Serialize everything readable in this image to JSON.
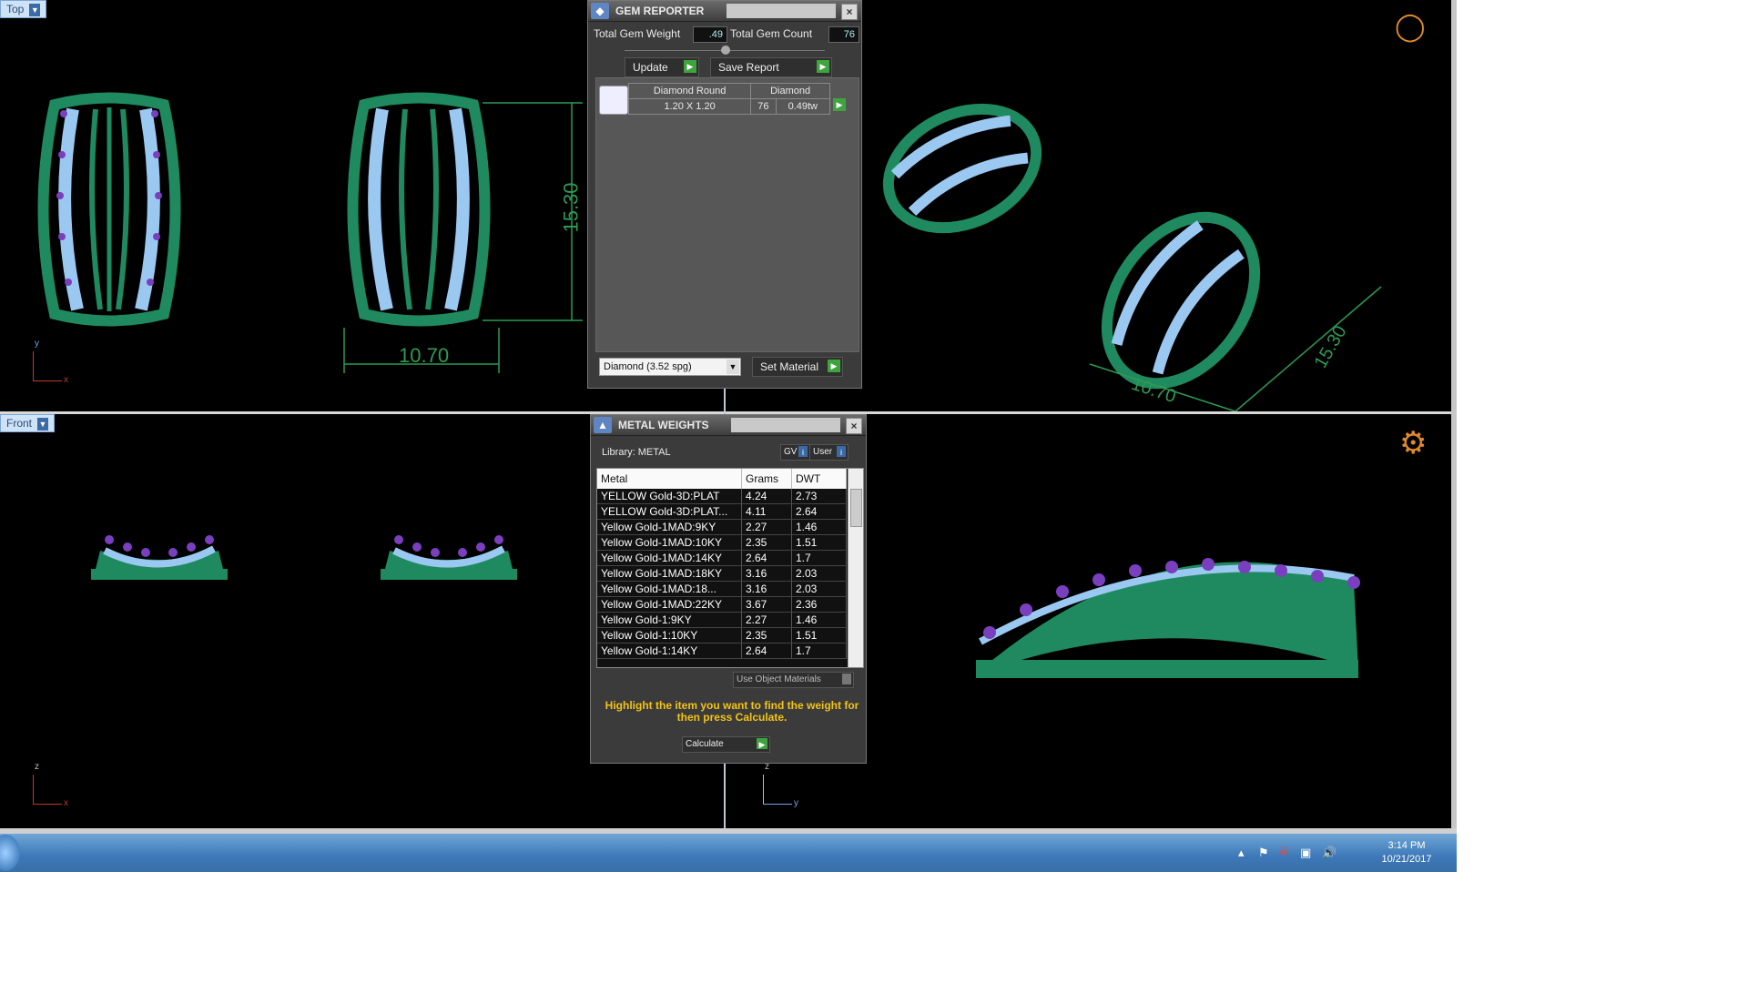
{
  "viewports": {
    "top": {
      "label": "Top",
      "dim_height": "15.30",
      "dim_width": "10.70",
      "axis_v": "y",
      "axis_h": "x"
    },
    "perspective": {
      "dim_width": "10.70",
      "dim_height": "15.30"
    },
    "front": {
      "label": "Front",
      "axis_v": "z",
      "axis_h": "x"
    },
    "right": {
      "axis_v": "z",
      "axis_h": "y"
    }
  },
  "gem_reporter": {
    "title": "GEM REPORTER",
    "total_weight_label": "Total Gem Weight",
    "total_weight_value": ".49",
    "total_count_label": "Total Gem Count",
    "total_count_value": "76",
    "update_label": "Update",
    "save_report_label": "Save Report",
    "gem": {
      "shape": "Diamond Round",
      "material": "Diamond",
      "size": "1.20 X 1.20",
      "count": "76",
      "weight": "0.49tw"
    },
    "material_select": "Diamond    (3.52 spg)",
    "set_material_label": "Set Material"
  },
  "metal_weights": {
    "title": "METAL WEIGHTS",
    "library_label": "Library: METAL",
    "gv_label": "GV",
    "user_label": "User",
    "headers": [
      "Metal",
      "Grams",
      "DWT"
    ],
    "rows": [
      [
        "YELLOW Gold-3D:PLAT",
        "4.24",
        "2.73"
      ],
      [
        "YELLOW Gold-3D:PLAT...",
        "4.11",
        "2.64"
      ],
      [
        "Yellow Gold-1MAD:9KY",
        "2.27",
        "1.46"
      ],
      [
        "Yellow Gold-1MAD:10KY",
        "2.35",
        "1.51"
      ],
      [
        "Yellow Gold-1MAD:14KY",
        "2.64",
        "1.7"
      ],
      [
        "Yellow Gold-1MAD:18KY",
        "3.16",
        "2.03"
      ],
      [
        "Yellow Gold-1MAD:18...",
        "3.16",
        "2.03"
      ],
      [
        "Yellow Gold-1MAD:22KY",
        "3.67",
        "2.36"
      ],
      [
        "Yellow Gold-1:9KY",
        "2.27",
        "1.46"
      ],
      [
        "Yellow Gold-1:10KY",
        "2.35",
        "1.51"
      ],
      [
        "Yellow Gold-1:14KY",
        "2.64",
        "1.7"
      ]
    ],
    "use_object_materials": "Use Object Materials",
    "hint": "Highlight the item you want to find the weight for then press Calculate.",
    "calculate_label": "Calculate"
  },
  "taskbar": {
    "time": "3:14 PM",
    "date": "10/21/2017"
  },
  "colors": {
    "metal": "#1f8a5f",
    "gem": "#9ac8f0",
    "prong": "#7a3fbf",
    "dimension": "#2e9a52"
  }
}
